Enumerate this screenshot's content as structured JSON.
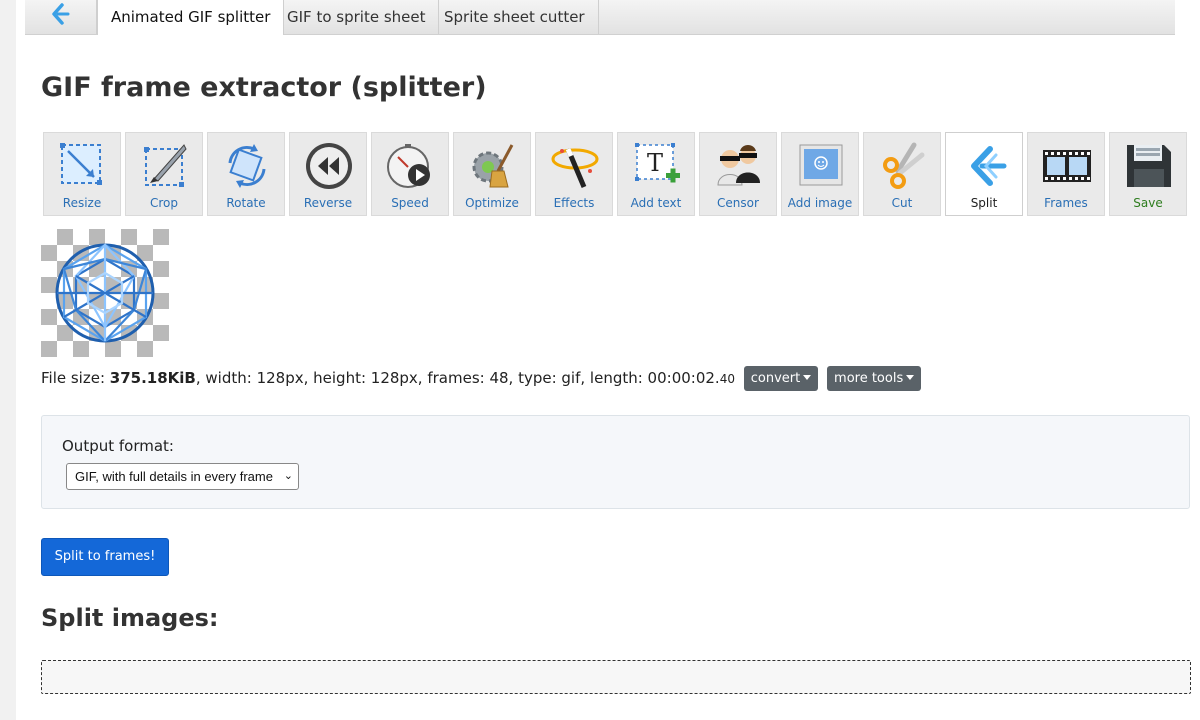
{
  "tabs": [
    {
      "label": "Animated GIF splitter",
      "active": true
    },
    {
      "label": "GIF to sprite sheet",
      "active": false
    },
    {
      "label": "Sprite sheet cutter",
      "active": false
    }
  ],
  "page_title": "GIF frame extractor (splitter)",
  "toolbar": {
    "tools": [
      {
        "label": "Resize",
        "icon": "resize-icon"
      },
      {
        "label": "Crop",
        "icon": "crop-icon"
      },
      {
        "label": "Rotate",
        "icon": "rotate-icon"
      },
      {
        "label": "Reverse",
        "icon": "reverse-icon"
      },
      {
        "label": "Speed",
        "icon": "speed-icon"
      },
      {
        "label": "Optimize",
        "icon": "optimize-icon"
      },
      {
        "label": "Effects",
        "icon": "effects-icon"
      },
      {
        "label": "Add text",
        "icon": "add-text-icon"
      },
      {
        "label": "Censor",
        "icon": "censor-icon"
      },
      {
        "label": "Add image",
        "icon": "add-image-icon"
      },
      {
        "label": "Cut",
        "icon": "cut-icon"
      },
      {
        "label": "Split",
        "icon": "split-icon",
        "active": true
      },
      {
        "label": "Frames",
        "icon": "frames-icon"
      },
      {
        "label": "Save",
        "icon": "save-icon"
      }
    ]
  },
  "fileinfo": {
    "size_label": "File size: ",
    "size_value": "375.18KiB",
    "details": ", width: 128px, height: 128px, frames: 48, type: gif, length: 00:00:02.",
    "length_fraction": "40"
  },
  "buttons": {
    "convert": "convert",
    "more_tools": "more tools",
    "split": "Split to frames!"
  },
  "options": {
    "output_format_label": "Output format:",
    "output_format_selected": "GIF, with full details in every frame"
  },
  "split_images_heading": "Split images:",
  "colors": {
    "primary": "#1468d8",
    "secondary_button": "#5a6268",
    "tool_label": "#2a6fb5",
    "save_label": "#2e7d1e"
  }
}
